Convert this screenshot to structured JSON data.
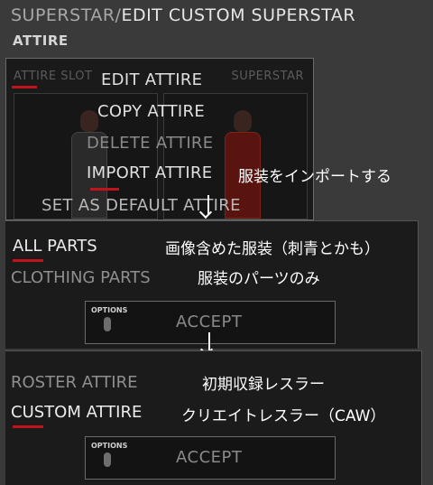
{
  "header": {
    "crumb": "SUPERSTAR",
    "separator": "/",
    "current": "EDIT CUSTOM SUPERSTAR",
    "subtitle": "ATTIRE"
  },
  "attire_panel": {
    "tab_slot": "ATTIRE SLOT",
    "tab_superstar": "SUPERSTAR",
    "menu": {
      "edit": "EDIT ATTIRE",
      "copy": "COPY ATTIRE",
      "delete": "DELETE ATTIRE",
      "import": "IMPORT ATTIRE",
      "set_default": "SET AS DEFAULT ATTIRE"
    }
  },
  "parts_panel": {
    "all_parts": "ALL PARTS",
    "clothing_parts": "CLOTHING PARTS",
    "options_label": "OPTIONS",
    "accept_label": "ACCEPT"
  },
  "source_panel": {
    "roster_attire": "ROSTER ATTIRE",
    "custom_attire": "CUSTOM ATTIRE",
    "options_label": "OPTIONS",
    "accept_label": "ACCEPT"
  },
  "annotations": {
    "import": "服装をインポートする",
    "all_parts": "画像含めた服装（刺青とかも）",
    "clothing_parts": "服装のパーツのみ",
    "roster_attire": "初期収録レスラー",
    "custom_attire": "クリエイトレスラー（CAW）"
  },
  "colors": {
    "accent_red": "#c2121c",
    "panel_bg": "#1b1b1b",
    "page_bg": "#3a3a3a"
  }
}
